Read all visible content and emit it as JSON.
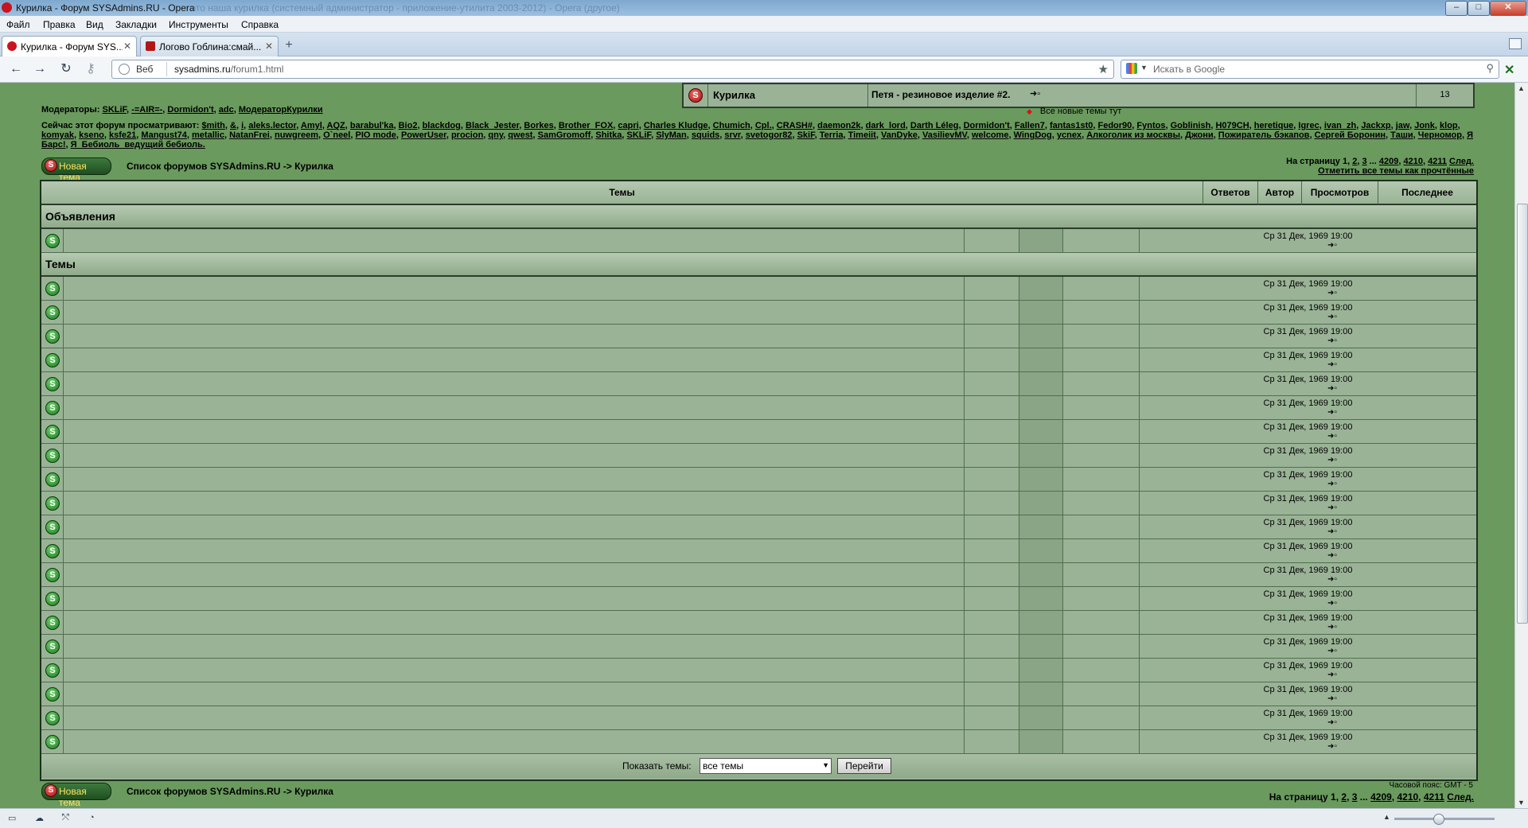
{
  "window": {
    "title": "Курилка - Форум SYSAdmins.RU - Opera",
    "title_faded": "это наша курилка (системный администратор - приложение-утилита 2003-2012) - Opera (другое)"
  },
  "menu": [
    "Файл",
    "Правка",
    "Вид",
    "Закладки",
    "Инструменты",
    "Справка"
  ],
  "tabs": [
    {
      "label": "Курилка - Форум SYS...",
      "active": true
    },
    {
      "label": "Логово Гоблина:смай...",
      "active": false
    }
  ],
  "address": {
    "web_label": "Веб",
    "url_host": "sysadmins.ru",
    "url_path": "/forum1.html",
    "search_placeholder": "Искать в Google"
  },
  "top_forum_row": {
    "forum": "Курилка",
    "last_topic": "Петя - резиновое изделие #2.",
    "count": "13"
  },
  "new_topics_note": "Все новые темы тут",
  "moderators": {
    "label": "Модераторы:",
    "names": [
      "SKLiF",
      "-=AIR=-",
      "Dormidon't",
      "adc",
      "МодераторКурилки"
    ]
  },
  "viewers": {
    "label": "Сейчас этот форум просматривают:",
    "names": [
      "$mith",
      "&",
      "i",
      "aleks.lector",
      "Amyl",
      "AQZ",
      "barabul'ka",
      "Bio2",
      "blackdog",
      "Black_Jester",
      "Borkes",
      "Brother_FOX",
      "capri",
      "Charles Kludge",
      "Chumich",
      "Cpl.",
      "CRASH#",
      "daemon2k",
      "dark_lord",
      "Darth Léleg",
      "Dormidon't",
      "Fallen7",
      "fantas1st0",
      "Fedor90",
      "Fyntos",
      "Goblinish",
      "H079CH",
      "heretique",
      "Igrec",
      "ivan_zh",
      "Jackxp",
      "jaw",
      "Jonk",
      "klop",
      "komyak",
      "kseno",
      "ksfe21",
      "Mangust74",
      "metallic",
      "NatanFrei",
      "nuwgreem",
      "O`neel",
      "PIO mode",
      "PowerUser",
      "procion",
      "qny",
      "qwest",
      "SamGromoff",
      "Shitka",
      "SKLiF",
      "SlyMan",
      "squids",
      "srvr",
      "svetogor82",
      "SkiF",
      "Terria",
      "Timeiit",
      "VanDyke",
      "VasilievMV",
      "welcome",
      "WingDog",
      "ycnex",
      "Алкоголик из москвы",
      "Джони",
      "Пожиратель бэкапов",
      "Сергей Боронин",
      "Таши",
      "Черномор",
      "Я Барс!",
      "Я_Бебиоль_ведущий бебиоль."
    ]
  },
  "new_topic_button": "Новая тема",
  "breadcrumb": "Список форумов SYSAdmins.RU -> Курилка",
  "pager": {
    "label": "На страницу",
    "pages": [
      "1",
      "2",
      "3",
      "...",
      "4209",
      "4210",
      "4211"
    ],
    "next": "След.",
    "mark_read": "Отметить все темы как прочтённые"
  },
  "table": {
    "headers": [
      "Темы",
      "Ответов",
      "Автор",
      "Просмотров",
      "Последнее сообщение"
    ],
    "section_announcements": "Объявления",
    "section_topics": "Темы",
    "row_last_post": "Ср 31 Дек, 1969 19:00",
    "announcement_rows": 1,
    "topic_rows": 20
  },
  "filter": {
    "label": "Показать темы:",
    "selected": "все темы",
    "go_button": "Перейти"
  },
  "timezone": "Часовой пояс: GMT - 5",
  "colors": {
    "page_bg": "#6a9a5e",
    "table_bg": "#9ab396",
    "button_text": "#ffe35b"
  }
}
